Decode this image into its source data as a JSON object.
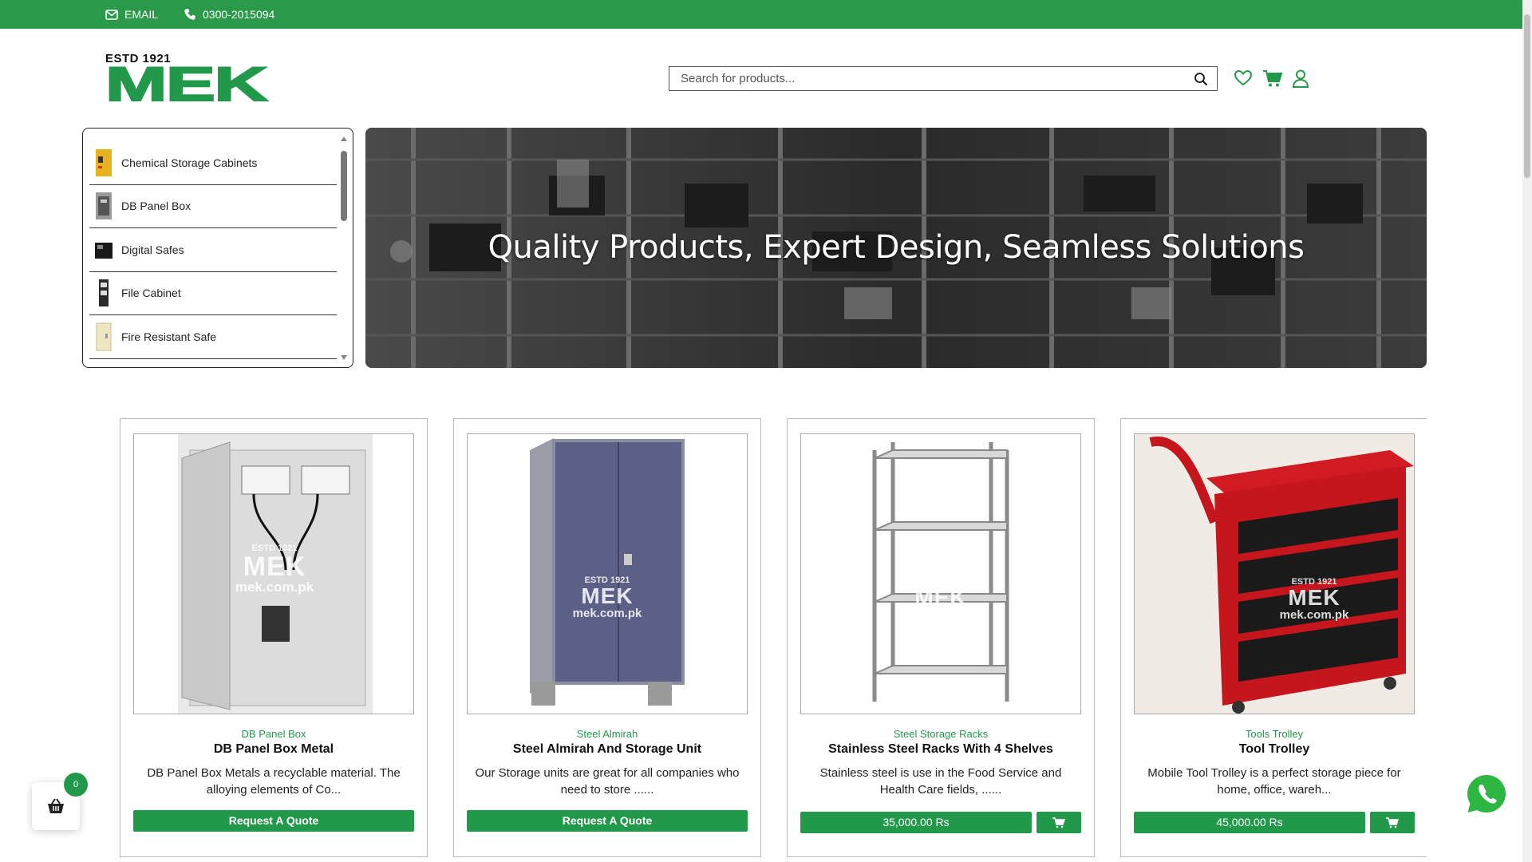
{
  "topbar": {
    "email_label": "EMAIL",
    "phone": "0300-2015094"
  },
  "logo": {
    "estd": "ESTD 1921",
    "brand": "MEK"
  },
  "search": {
    "placeholder": "Search for products..."
  },
  "header_icons": [
    "heart-icon",
    "cart-icon",
    "user-icon"
  ],
  "categories": [
    {
      "label": "Chemical Storage Cabinets"
    },
    {
      "label": "DB Panel Box"
    },
    {
      "label": "Digital Safes"
    },
    {
      "label": "File Cabinet"
    },
    {
      "label": "Fire Resistant Safe"
    }
  ],
  "hero": {
    "headline": "Quality Products, Expert Design, Seamless Solutions"
  },
  "products": [
    {
      "category": "DB Panel Box",
      "title": "DB Panel Box Metal",
      "desc": "DB Panel Box Metals a recyclable material. The alloying elements of Co...",
      "action": "Request A Quote"
    },
    {
      "category": "Steel Almirah",
      "title": "Steel Almirah And Storage Unit",
      "desc": "Our Storage units are great for all companies who need to store ......",
      "action": "Request A Quote"
    },
    {
      "category": "Steel Storage Racks",
      "title": "Stainless Steel Racks With 4 Shelves",
      "desc": "Stainless steel is use in the Food Service and Health Care fields, ......",
      "price": "35,000.00 Rs"
    },
    {
      "category": "Tools Trolley",
      "title": "Tool Trolley",
      "desc": "Mobile Tool Trolley is a perfect storage piece for home, office, wareh...",
      "price": "45,000.00 Rs"
    }
  ],
  "watermark": {
    "estd": "ESTD 1921",
    "brand": "MEK",
    "url": "mek.com.pk"
  },
  "floating_cart": {
    "count": "0"
  },
  "colors": {
    "brand_green": "#22994a",
    "topbar_green": "#2a9a4a"
  }
}
